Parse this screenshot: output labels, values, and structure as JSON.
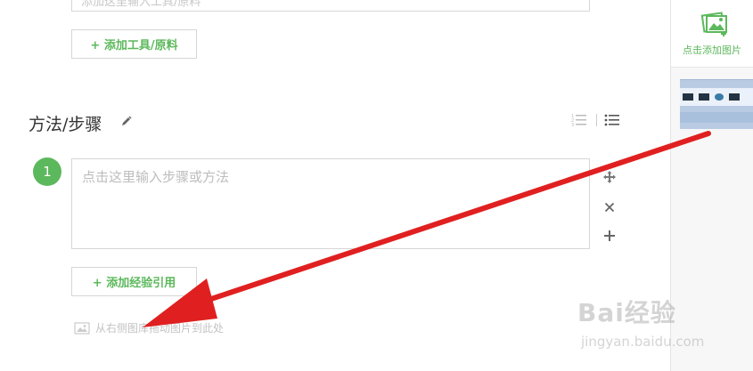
{
  "tools_section": {
    "input_placeholder": "添加这里输入工具/原料",
    "add_button_label": "+ 添加工具/原料"
  },
  "steps_section": {
    "title": "方法/步骤",
    "steps": [
      {
        "number": "1",
        "placeholder": "点击这里输入步骤或方法"
      }
    ],
    "add_quote_label": "+ 添加经验引用",
    "drag_hint": "从右侧图库拖动图片到此处"
  },
  "right_panel": {
    "add_picture_label": "点击添加图片"
  },
  "watermark": {
    "brand": "Bai经验",
    "url": "jingyan.baidu.com"
  },
  "colors": {
    "accent_green": "#5cb85c",
    "arrow_red": "#e02020"
  },
  "icons": {
    "edit": "pencil-icon",
    "ordered_list": "ordered-list-icon",
    "unordered_list": "unordered-list-icon",
    "move": "move-icon",
    "remove": "close-icon",
    "add_step": "plus-icon",
    "add_picture": "add-picture-icon",
    "drag_hint": "image-icon"
  }
}
